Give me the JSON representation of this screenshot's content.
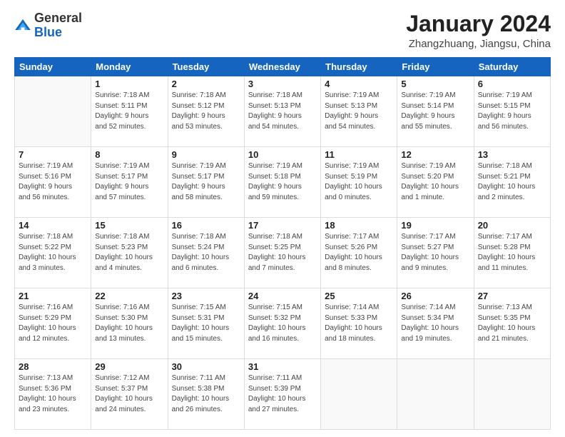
{
  "header": {
    "logo_general": "General",
    "logo_blue": "Blue",
    "month_year": "January 2024",
    "location": "Zhangzhuang, Jiangsu, China"
  },
  "weekdays": [
    "Sunday",
    "Monday",
    "Tuesday",
    "Wednesday",
    "Thursday",
    "Friday",
    "Saturday"
  ],
  "weeks": [
    [
      {
        "day": "",
        "info": ""
      },
      {
        "day": "1",
        "info": "Sunrise: 7:18 AM\nSunset: 5:11 PM\nDaylight: 9 hours\nand 52 minutes."
      },
      {
        "day": "2",
        "info": "Sunrise: 7:18 AM\nSunset: 5:12 PM\nDaylight: 9 hours\nand 53 minutes."
      },
      {
        "day": "3",
        "info": "Sunrise: 7:18 AM\nSunset: 5:13 PM\nDaylight: 9 hours\nand 54 minutes."
      },
      {
        "day": "4",
        "info": "Sunrise: 7:19 AM\nSunset: 5:13 PM\nDaylight: 9 hours\nand 54 minutes."
      },
      {
        "day": "5",
        "info": "Sunrise: 7:19 AM\nSunset: 5:14 PM\nDaylight: 9 hours\nand 55 minutes."
      },
      {
        "day": "6",
        "info": "Sunrise: 7:19 AM\nSunset: 5:15 PM\nDaylight: 9 hours\nand 56 minutes."
      }
    ],
    [
      {
        "day": "7",
        "info": "Sunrise: 7:19 AM\nSunset: 5:16 PM\nDaylight: 9 hours\nand 56 minutes."
      },
      {
        "day": "8",
        "info": "Sunrise: 7:19 AM\nSunset: 5:17 PM\nDaylight: 9 hours\nand 57 minutes."
      },
      {
        "day": "9",
        "info": "Sunrise: 7:19 AM\nSunset: 5:17 PM\nDaylight: 9 hours\nand 58 minutes."
      },
      {
        "day": "10",
        "info": "Sunrise: 7:19 AM\nSunset: 5:18 PM\nDaylight: 9 hours\nand 59 minutes."
      },
      {
        "day": "11",
        "info": "Sunrise: 7:19 AM\nSunset: 5:19 PM\nDaylight: 10 hours\nand 0 minutes."
      },
      {
        "day": "12",
        "info": "Sunrise: 7:19 AM\nSunset: 5:20 PM\nDaylight: 10 hours\nand 1 minute."
      },
      {
        "day": "13",
        "info": "Sunrise: 7:18 AM\nSunset: 5:21 PM\nDaylight: 10 hours\nand 2 minutes."
      }
    ],
    [
      {
        "day": "14",
        "info": "Sunrise: 7:18 AM\nSunset: 5:22 PM\nDaylight: 10 hours\nand 3 minutes."
      },
      {
        "day": "15",
        "info": "Sunrise: 7:18 AM\nSunset: 5:23 PM\nDaylight: 10 hours\nand 4 minutes."
      },
      {
        "day": "16",
        "info": "Sunrise: 7:18 AM\nSunset: 5:24 PM\nDaylight: 10 hours\nand 6 minutes."
      },
      {
        "day": "17",
        "info": "Sunrise: 7:18 AM\nSunset: 5:25 PM\nDaylight: 10 hours\nand 7 minutes."
      },
      {
        "day": "18",
        "info": "Sunrise: 7:17 AM\nSunset: 5:26 PM\nDaylight: 10 hours\nand 8 minutes."
      },
      {
        "day": "19",
        "info": "Sunrise: 7:17 AM\nSunset: 5:27 PM\nDaylight: 10 hours\nand 9 minutes."
      },
      {
        "day": "20",
        "info": "Sunrise: 7:17 AM\nSunset: 5:28 PM\nDaylight: 10 hours\nand 11 minutes."
      }
    ],
    [
      {
        "day": "21",
        "info": "Sunrise: 7:16 AM\nSunset: 5:29 PM\nDaylight: 10 hours\nand 12 minutes."
      },
      {
        "day": "22",
        "info": "Sunrise: 7:16 AM\nSunset: 5:30 PM\nDaylight: 10 hours\nand 13 minutes."
      },
      {
        "day": "23",
        "info": "Sunrise: 7:15 AM\nSunset: 5:31 PM\nDaylight: 10 hours\nand 15 minutes."
      },
      {
        "day": "24",
        "info": "Sunrise: 7:15 AM\nSunset: 5:32 PM\nDaylight: 10 hours\nand 16 minutes."
      },
      {
        "day": "25",
        "info": "Sunrise: 7:14 AM\nSunset: 5:33 PM\nDaylight: 10 hours\nand 18 minutes."
      },
      {
        "day": "26",
        "info": "Sunrise: 7:14 AM\nSunset: 5:34 PM\nDaylight: 10 hours\nand 19 minutes."
      },
      {
        "day": "27",
        "info": "Sunrise: 7:13 AM\nSunset: 5:35 PM\nDaylight: 10 hours\nand 21 minutes."
      }
    ],
    [
      {
        "day": "28",
        "info": "Sunrise: 7:13 AM\nSunset: 5:36 PM\nDaylight: 10 hours\nand 23 minutes."
      },
      {
        "day": "29",
        "info": "Sunrise: 7:12 AM\nSunset: 5:37 PM\nDaylight: 10 hours\nand 24 minutes."
      },
      {
        "day": "30",
        "info": "Sunrise: 7:11 AM\nSunset: 5:38 PM\nDaylight: 10 hours\nand 26 minutes."
      },
      {
        "day": "31",
        "info": "Sunrise: 7:11 AM\nSunset: 5:39 PM\nDaylight: 10 hours\nand 27 minutes."
      },
      {
        "day": "",
        "info": ""
      },
      {
        "day": "",
        "info": ""
      },
      {
        "day": "",
        "info": ""
      }
    ]
  ]
}
